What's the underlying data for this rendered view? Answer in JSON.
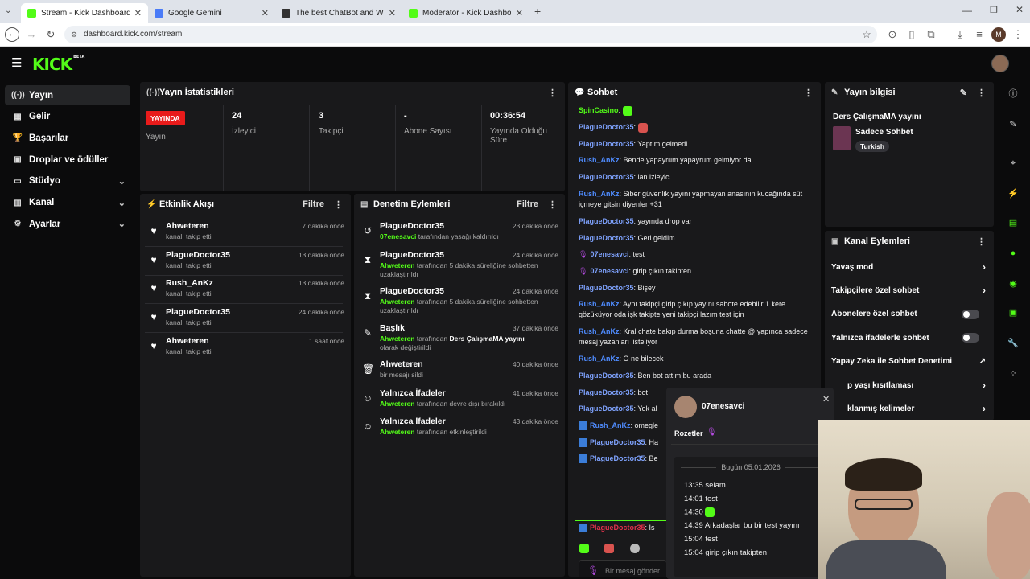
{
  "browser": {
    "tabs": [
      {
        "title": "Stream - Kick Dashboard",
        "active": true,
        "fav_color": "#53fc18"
      },
      {
        "title": "Google Gemini",
        "active": false,
        "fav_color": "#4a7bf7"
      },
      {
        "title": "The best ChatBot and Widgets",
        "active": false,
        "fav_color": "#333333"
      },
      {
        "title": "Moderator - Kick Dashboard",
        "active": false,
        "fav_color": "#53fc18"
      }
    ],
    "url": "dashboard.kick.com/stream",
    "profile_initial": "M"
  },
  "app": {
    "logo": "KICK",
    "logo_badge": "BETA",
    "accent": "#53fc18",
    "sidebar": [
      {
        "label": "Yayın",
        "icon": "broadcast-icon",
        "active": true,
        "expand": false
      },
      {
        "label": "Gelir",
        "icon": "revenue-icon",
        "active": false,
        "expand": false
      },
      {
        "label": "Başarılar",
        "icon": "trophy-icon",
        "active": false,
        "expand": false
      },
      {
        "label": "Droplar ve ödüller",
        "icon": "gift-icon",
        "active": false,
        "expand": false
      },
      {
        "label": "Stüdyo",
        "icon": "studio-icon",
        "active": false,
        "expand": true
      },
      {
        "label": "Kanal",
        "icon": "channel-icon",
        "active": false,
        "expand": true
      },
      {
        "label": "Ayarlar",
        "icon": "gear-icon",
        "active": false,
        "expand": true
      }
    ]
  },
  "stats": {
    "title": "Yayın İstatistikleri",
    "live_badge": "YAYINDA",
    "items": [
      {
        "value": "",
        "label": "Yayın"
      },
      {
        "value": "24",
        "label": "İzleyici"
      },
      {
        "value": "3",
        "label": "Takipçi"
      },
      {
        "value": "-",
        "label": "Abone Sayısı"
      },
      {
        "value": "00:36:54",
        "label": "Yayında Olduğu Süre"
      }
    ]
  },
  "activity": {
    "title": "Etkinlik Akışı",
    "filter": "Filtre",
    "items": [
      {
        "name": "Ahweteren",
        "sub": "kanalı takip etti",
        "time": "7 dakika önce"
      },
      {
        "name": "PlagueDoctor35",
        "sub": "kanalı takip etti",
        "time": "13 dakika önce"
      },
      {
        "name": "Rush_AnKz",
        "sub": "kanalı takip etti",
        "time": "13 dakika önce"
      },
      {
        "name": "PlagueDoctor35",
        "sub": "kanalı takip etti",
        "time": "24 dakika önce"
      },
      {
        "name": "Ahweteren",
        "sub": "kanalı takip etti",
        "time": "1 saat önce"
      }
    ]
  },
  "moderation": {
    "title": "Denetim Eylemleri",
    "filter": "Filtre",
    "items": [
      {
        "name": "PlagueDoctor35",
        "actor": "07enesavci",
        "rest": " tarafından yasağı kaldırıldı",
        "time": "23 dakika önce",
        "icon": "unban-icon",
        "glyph": "↺"
      },
      {
        "name": "PlagueDoctor35",
        "actor": "Ahweteren",
        "rest": " tarafından 5 dakika süreliğine sohbetten uzaklaştırıldı",
        "time": "24 dakika önce",
        "icon": "hourglass-icon",
        "glyph": "⧗"
      },
      {
        "name": "PlagueDoctor35",
        "actor": "Ahweteren",
        "rest": " tarafından 5 dakika süreliğine sohbetten uzaklaştırıldı",
        "time": "24 dakika önce",
        "icon": "hourglass-icon",
        "glyph": "⧗"
      },
      {
        "name": "Başlık",
        "actor": "Ahweteren",
        "rest": " tarafından ",
        "extra": "Ders ÇalışmaMA yayını",
        "rest2": " olarak değiştirildi",
        "time": "37 dakika önce",
        "icon": "user-edit-icon",
        "glyph": "✎"
      },
      {
        "name": "Ahweteren",
        "actor": "",
        "rest": "bir mesajı sildi",
        "time": "40 dakika önce",
        "icon": "trash-icon",
        "glyph": "🗑"
      },
      {
        "name": "Yalnızca İfadeler",
        "actor": "Ahweteren",
        "rest": " tarafından devre dışı bırakıldı",
        "time": "41 dakika önce",
        "icon": "emoji-icon",
        "glyph": "☺"
      },
      {
        "name": "Yalnızca İfadeler",
        "actor": "Ahweteren",
        "rest": " tarafından etkinleştirildi",
        "time": "43 dakika önce",
        "icon": "emoji-icon",
        "glyph": "☺"
      }
    ]
  },
  "chat": {
    "title": "Sohbet",
    "placeholder": "Bir mesaj gönder",
    "messages": [
      {
        "user": "SpinCasino",
        "color": "#53fc18",
        "text": "",
        "emote": "#53fc18",
        "badge": ""
      },
      {
        "user": "PlagueDoctor35",
        "color": "#7fa3ff",
        "text": "",
        "emote": "#d9534f",
        "badge": ""
      },
      {
        "user": "PlagueDoctor35",
        "color": "#7fa3ff",
        "text": "Yaptım gelmedi",
        "badge": ""
      },
      {
        "user": "Rush_AnKz",
        "color": "#4f8cff",
        "text": "Bende yapayrum yapayrum gelmiyor da",
        "badge": ""
      },
      {
        "user": "PlagueDoctor35",
        "color": "#7fa3ff",
        "text": "lan izleyici",
        "badge": ""
      },
      {
        "user": "Rush_AnKz",
        "color": "#4f8cff",
        "text": "Siber güvenlik yayını yapmayan anasının kucağında süt içmeye gitsin diyenler +31",
        "badge": ""
      },
      {
        "user": "PlagueDoctor35",
        "color": "#7fa3ff",
        "text": "yayında drop var",
        "badge": ""
      },
      {
        "user": "PlagueDoctor35",
        "color": "#7fa3ff",
        "text": "Geri geldim",
        "badge": ""
      },
      {
        "user": "07enesavci",
        "color": "#7fa3ff",
        "text": "test",
        "badge": "mic"
      },
      {
        "user": "07enesavci",
        "color": "#7fa3ff",
        "text": "girip çıkın takipten",
        "badge": "mic"
      },
      {
        "user": "PlagueDoctor35",
        "color": "#7fa3ff",
        "text": "Bişey",
        "badge": ""
      },
      {
        "user": "Rush_AnKz",
        "color": "#4f8cff",
        "text": "Aynı takipçi girip çıkıp yayını sabote edebilir 1 kere gözüküyor oda işk takipte yeni takipçi lazım test için",
        "badge": ""
      },
      {
        "user": "Rush_AnKz",
        "color": "#4f8cff",
        "text": "Kral chate bakıp durma boşuna chatte @ yapınca sadece mesaj yazanları listeliyor",
        "badge": ""
      },
      {
        "user": "Rush_AnKz",
        "color": "#4f8cff",
        "text": "O ne bilecek",
        "badge": ""
      },
      {
        "user": "PlagueDoctor35",
        "color": "#7fa3ff",
        "text": "Ben bot attım bu arada",
        "badge": ""
      },
      {
        "user": "PlagueDoctor35",
        "color": "#7fa3ff",
        "text": "bot",
        "badge": ""
      },
      {
        "user": "PlagueDoctor35",
        "color": "#7fa3ff",
        "text": "Yok al",
        "badge": ""
      },
      {
        "user": "Rush_AnKz",
        "color": "#4f8cff",
        "text": "omegle",
        "badge": "mod"
      },
      {
        "user": "PlagueDoctor35",
        "color": "#7fa3ff",
        "text": "Ha",
        "badge": "mod"
      },
      {
        "user": "PlagueDoctor35",
        "color": "#7fa3ff",
        "text": "Be",
        "badge": "mod"
      }
    ],
    "pinned": {
      "user": "PlagueDoctor35",
      "text": "İs"
    }
  },
  "stream_info": {
    "title": "Yayın bilgisi",
    "stream_title": "Ders ÇalışmaMA yayını",
    "category": "Sadece Sohbet",
    "tag": "Turkish"
  },
  "channel_actions": {
    "title": "Kanal Eylemleri",
    "rows": [
      {
        "label": "Yavaş mod",
        "kind": "arrow"
      },
      {
        "label": "Takipçilere özel sohbet",
        "kind": "arrow"
      },
      {
        "label": "Abonelere özel sohbet",
        "kind": "toggle"
      },
      {
        "label": "Yalnızca ifadelerle sohbet",
        "kind": "toggle"
      },
      {
        "label": "Yapay Zeka ile Sohbet Denetimi",
        "kind": "external"
      },
      {
        "label": "p yaşı kısıtlaması",
        "kind": "arrow"
      },
      {
        "label": "klanmış kelimeler",
        "kind": "arrow"
      }
    ]
  },
  "user_card": {
    "username": "07enesavci",
    "badges_label": "Rozetler",
    "date": "Bugün 05.01.2026",
    "history": [
      {
        "time": "13:35",
        "text": "selam"
      },
      {
        "time": "14:01",
        "text": "test"
      },
      {
        "time": "14:30",
        "text": ""
      },
      {
        "time": "14:39",
        "text": "Arkadaşlar bu bir test yayını"
      },
      {
        "time": "15:04",
        "text": "test"
      },
      {
        "time": "15:04",
        "text": "girip çıkın takipten"
      }
    ]
  }
}
